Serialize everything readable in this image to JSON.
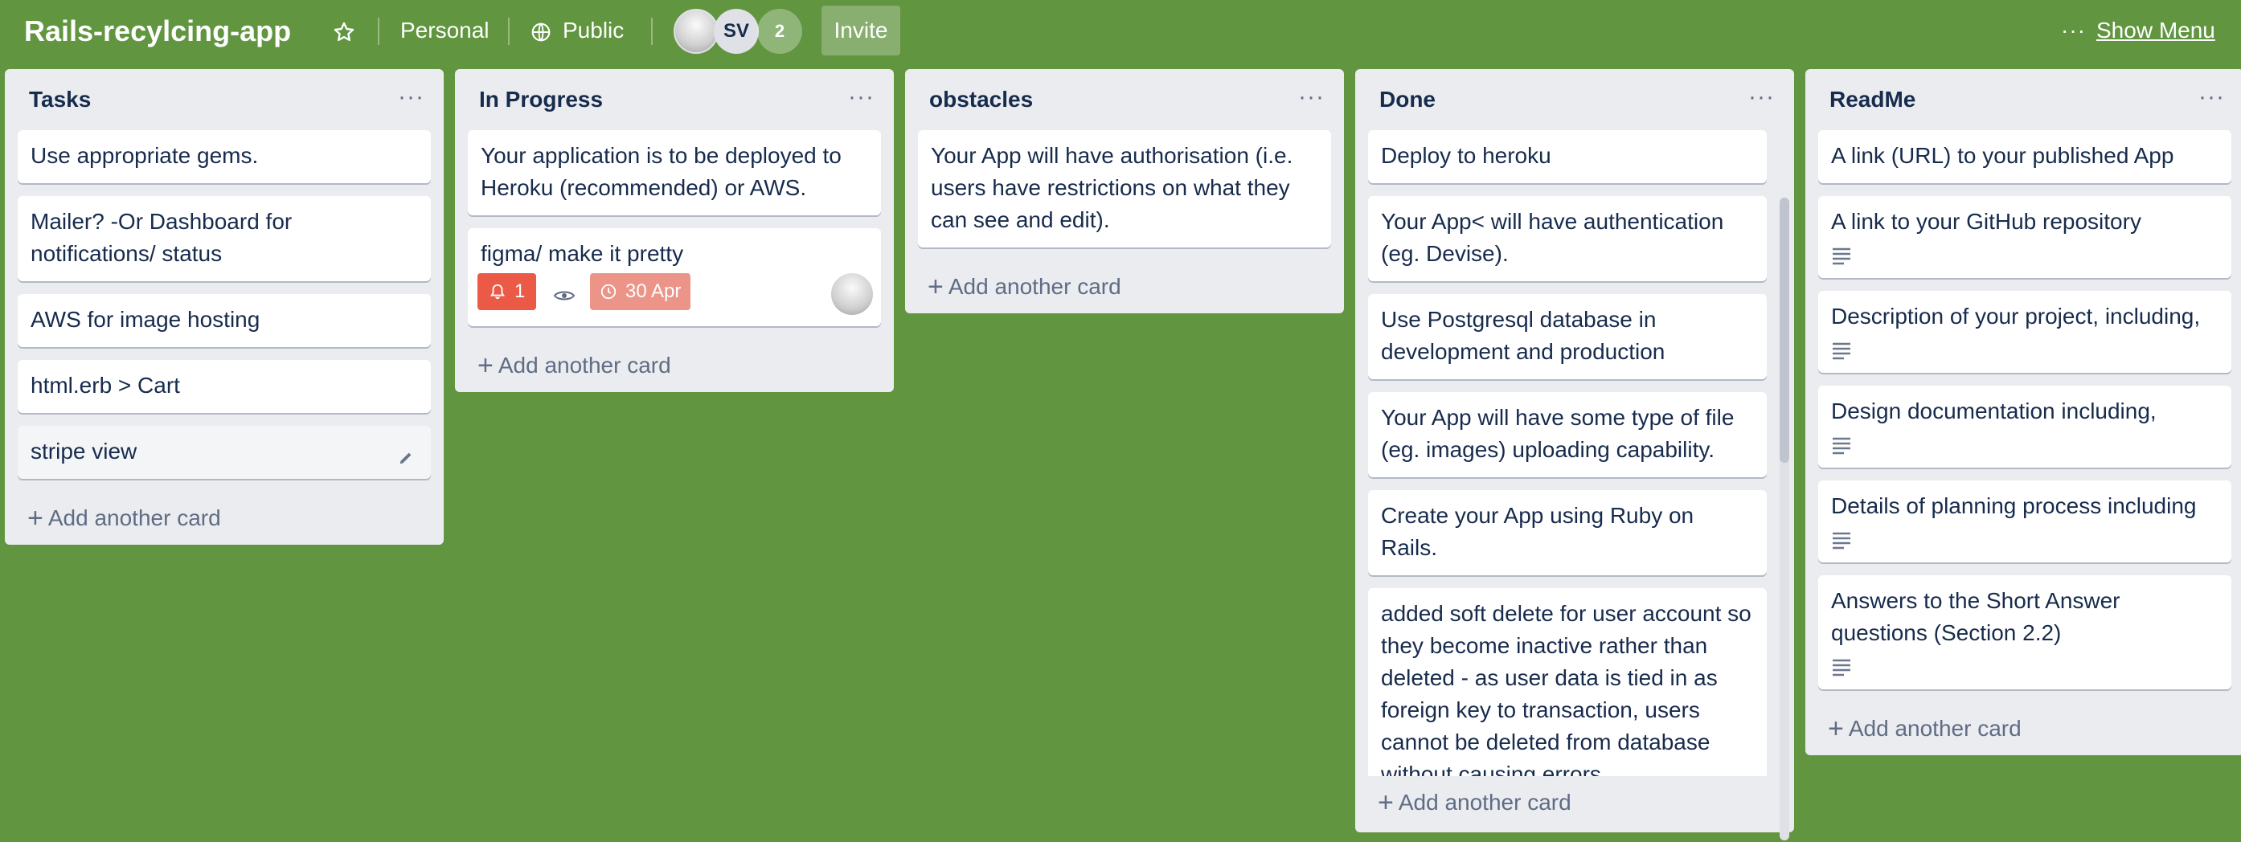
{
  "colors": {
    "board_background": "#61953f",
    "list_background": "#ebecf0",
    "card_background": "#ffffff",
    "notification_badge": "#eb5a46",
    "due_badge": "#ec9488"
  },
  "header": {
    "board_title": "Rails-recylcing-app",
    "star_icon": "star-icon",
    "team_label": "Personal",
    "visibility_icon": "globe-icon",
    "visibility_label": "Public",
    "avatar_initials": "SV",
    "extra_members_count": "2",
    "invite_label": "Invite",
    "menu_dots": "···",
    "show_menu_label": "Show Menu"
  },
  "lists": [
    {
      "title": "Tasks",
      "menu": "···",
      "add_label": "Add another card",
      "cards": [
        {
          "text": "Use appropriate gems."
        },
        {
          "text": "Mailer? -Or Dashboard for notifications/ status"
        },
        {
          "text": "AWS for image hosting"
        },
        {
          "text": "html.erb > Cart"
        },
        {
          "text": "stripe view"
        }
      ]
    },
    {
      "title": "In Progress",
      "menu": "···",
      "add_label": "Add another card",
      "cards": [
        {
          "text": "Your application is to be deployed to Heroku (recommended) or AWS."
        },
        {
          "text": "figma/ make it pretty",
          "notification_count": "1",
          "due_date": "30 Apr"
        }
      ]
    },
    {
      "title": "obstacles",
      "menu": "···",
      "add_label": "Add another card",
      "cards": [
        {
          "text": "Your App will have authorisation (i.e. users have restrictions on what they can see and edit)."
        }
      ]
    },
    {
      "title": "Done",
      "menu": "···",
      "add_label": "Add another card",
      "cards": [
        {
          "text": "Deploy to heroku"
        },
        {
          "text": "Your App< will have authentication (eg. Devise)."
        },
        {
          "text": "Use Postgresql database in development and production"
        },
        {
          "text": "Your App will have some type of file (eg. images) uploading capability."
        },
        {
          "text": "Create your App using Ruby on Rails."
        },
        {
          "text": "added soft delete for user account so they become inactive rather than deleted - as user data is tied in as foreign key to transaction, users cannot be deleted from database without causing errors"
        }
      ]
    },
    {
      "title": "ReadMe",
      "menu": "···",
      "add_label": "Add another card",
      "cards": [
        {
          "text": "A link (URL) to your published App"
        },
        {
          "text": "A link to your GitHub repository"
        },
        {
          "text": "Description of your project, including,"
        },
        {
          "text": "Design documentation including,"
        },
        {
          "text": "Details of planning process including"
        },
        {
          "text": "Answers to the Short Answer questions (Section 2.2)"
        }
      ]
    }
  ]
}
